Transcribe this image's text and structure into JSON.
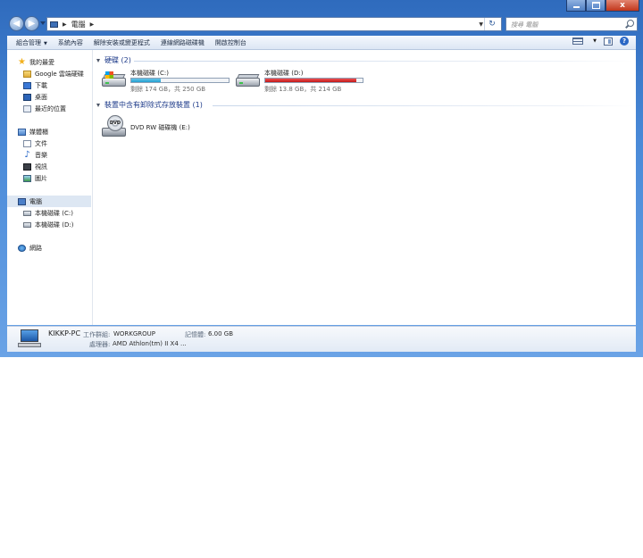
{
  "window": {
    "controls": {
      "minimize": "",
      "maximize": "",
      "close": "x"
    }
  },
  "address": {
    "crumbs": [
      "電腦"
    ],
    "search_placeholder": "搜尋 電腦"
  },
  "toolbar": {
    "organize": "組合管理",
    "system_properties": "系統內容",
    "uninstall": "解除安裝或變更程式",
    "map_drive": "連線網路磁碟機",
    "control_panel": "開啟控制台"
  },
  "nav": {
    "favorites": "我的最愛",
    "google_drive": "Google 雲端硬碟",
    "downloads": "下載",
    "desktop": "桌面",
    "recent": "最近的位置",
    "libraries": "媒體櫃",
    "documents": "文件",
    "music": "音樂",
    "videos": "視訊",
    "pictures": "圖片",
    "computer": "電腦",
    "drive_c": "本機磁碟 (C:)",
    "drive_d": "本機磁碟 (D:)",
    "network": "網路"
  },
  "main": {
    "hdd_group": "硬碟 (2)",
    "removable_group": "裝置中含有卸除式存放裝置 (1)",
    "drives": [
      {
        "name": "本機磁碟 (C:)",
        "free": "剩餘 174 GB，共 250 GB",
        "used_fraction": 0.3,
        "state": "normal"
      },
      {
        "name": "本機磁碟 (D:)",
        "free": "剩餘 13.8 GB，共 214 GB",
        "used_fraction": 0.94,
        "state": "critical"
      }
    ],
    "dvd": {
      "name": "DVD RW 磁碟機 (E:)",
      "icon_label": "DVD"
    }
  },
  "details": {
    "pc_name": "KIKKP-PC",
    "workgroup_label": "工作群組:",
    "workgroup": "WORKGROUP",
    "memory_label": "記憶體:",
    "memory": "6.00 GB",
    "processor_label": "處理器:",
    "processor": "AMD Athlon(tm) II X4 ..."
  },
  "colors": {
    "accent": "#1e3b8a",
    "bar_normal": "#239fd0",
    "bar_critical": "#c01a1a"
  }
}
